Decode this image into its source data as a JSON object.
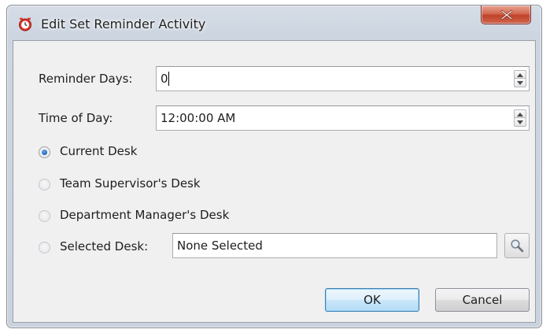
{
  "window": {
    "title": "Edit Set Reminder Activity",
    "close_glyph": "×"
  },
  "form": {
    "reminder_days_label": "Reminder Days:",
    "reminder_days_value": "0",
    "time_of_day_label": "Time of Day:",
    "time_of_day_value": "12:00:00 AM",
    "desk_options": [
      {
        "label": "Current Desk",
        "selected": true
      },
      {
        "label": "Team Supervisor's Desk",
        "selected": false
      },
      {
        "label": "Department Manager's Desk",
        "selected": false
      },
      {
        "label": "Selected Desk:",
        "selected": false
      }
    ],
    "selected_desk_value": "None Selected"
  },
  "buttons": {
    "ok_label": "OK",
    "cancel_label": "Cancel"
  },
  "icons": {
    "app": "reminder-clock-icon",
    "close": "close-icon",
    "lookup": "magnifier-icon",
    "spin_up": "chevron-up-icon",
    "spin_down": "chevron-down-icon"
  },
  "colors": {
    "title_bar": "#ccd5e0",
    "close_button": "#c7472d",
    "client_background": "#f0f0f0",
    "radio_selected": "#1f65b8"
  }
}
